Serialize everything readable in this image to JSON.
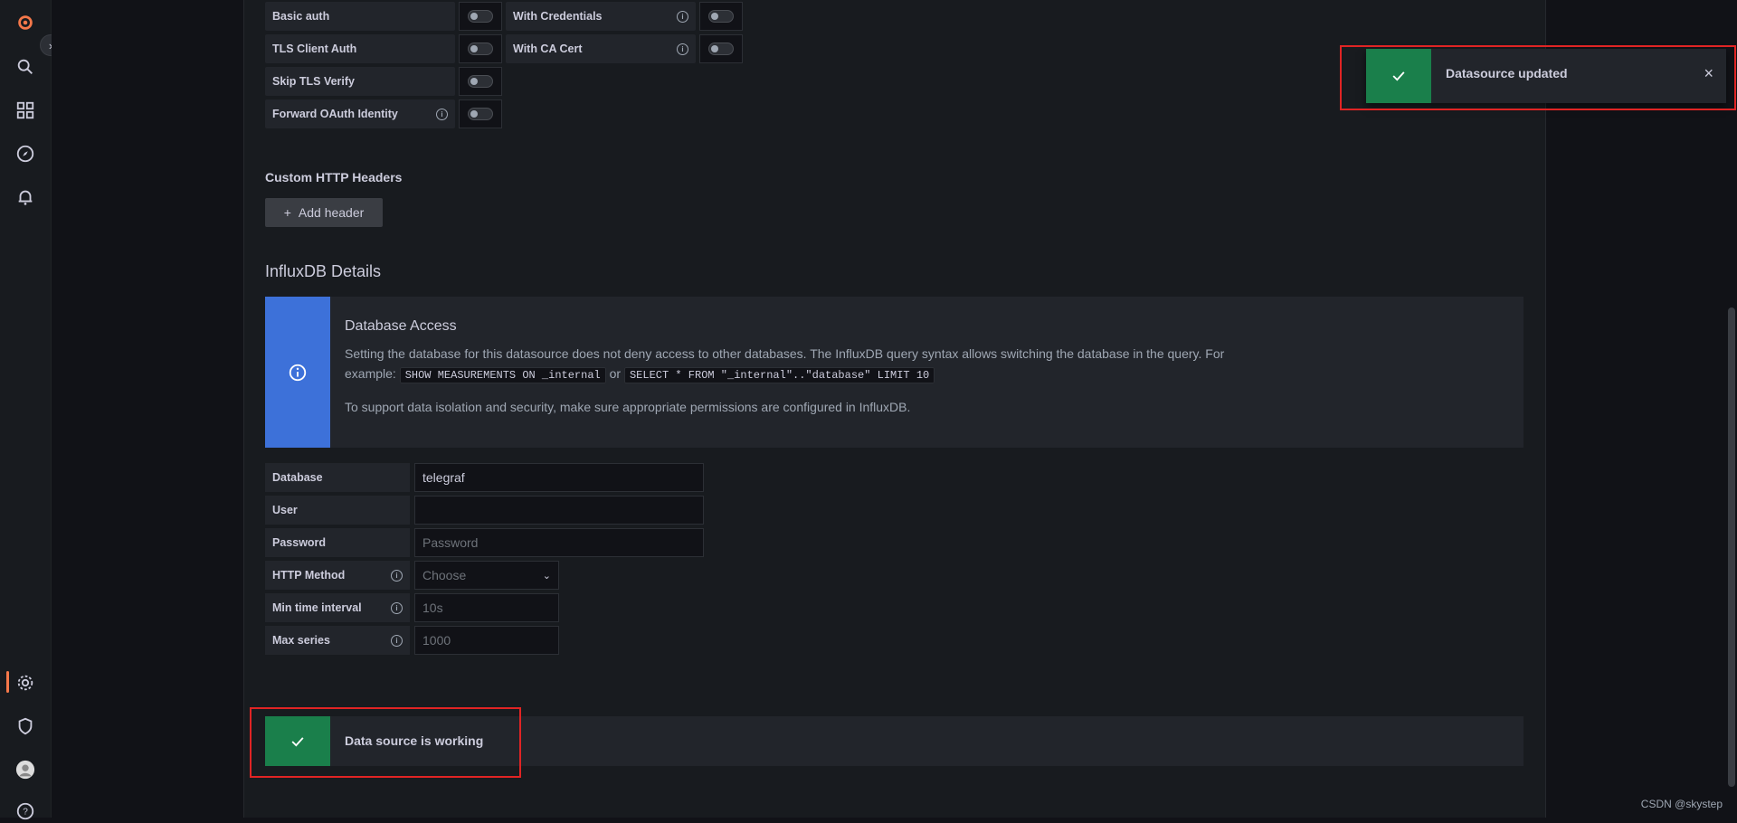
{
  "sidebar": {
    "icons": [
      "grafana-logo-icon",
      "search-icon",
      "dashboards-icon",
      "explore-icon",
      "alerting-icon",
      "configuration-icon",
      "server-admin-icon",
      "user-avatar-icon",
      "help-icon"
    ]
  },
  "auth": {
    "basic_auth": "Basic auth",
    "with_credentials": "With Credentials",
    "tls_client_auth": "TLS Client Auth",
    "with_ca_cert": "With CA Cert",
    "skip_tls_verify": "Skip TLS Verify",
    "forward_oauth": "Forward OAuth Identity"
  },
  "headers": {
    "title": "Custom HTTP Headers",
    "add_label": "Add header"
  },
  "influx": {
    "title": "InfluxDB Details",
    "info_title": "Database Access",
    "info_text_part1": "Setting the database for this datasource does not deny access to other databases. The InfluxDB query syntax allows switching the database in the query. For example:",
    "code1": "SHOW MEASUREMENTS ON _internal",
    "or_text": "or",
    "code2": "SELECT * FROM \"_internal\"..\"database\" LIMIT 10",
    "info_text_part2": "To support data isolation and security, make sure appropriate permissions are configured in InfluxDB."
  },
  "fields": {
    "database_label": "Database",
    "database_value": "telegraf",
    "user_label": "User",
    "user_value": "",
    "password_label": "Password",
    "password_placeholder": "Password",
    "http_method_label": "HTTP Method",
    "http_method_placeholder": "Choose",
    "min_time_label": "Min time interval",
    "min_time_placeholder": "10s",
    "max_series_label": "Max series",
    "max_series_placeholder": "1000"
  },
  "status": {
    "working_text": "Data source is working"
  },
  "toast": {
    "text": "Datasource updated",
    "close": "×"
  },
  "watermark": "CSDN @skystep",
  "colors": {
    "success": "#1a7f4b",
    "info": "#3d71d9",
    "highlight_border": "#e02424",
    "active_accent": "#f5784a"
  }
}
